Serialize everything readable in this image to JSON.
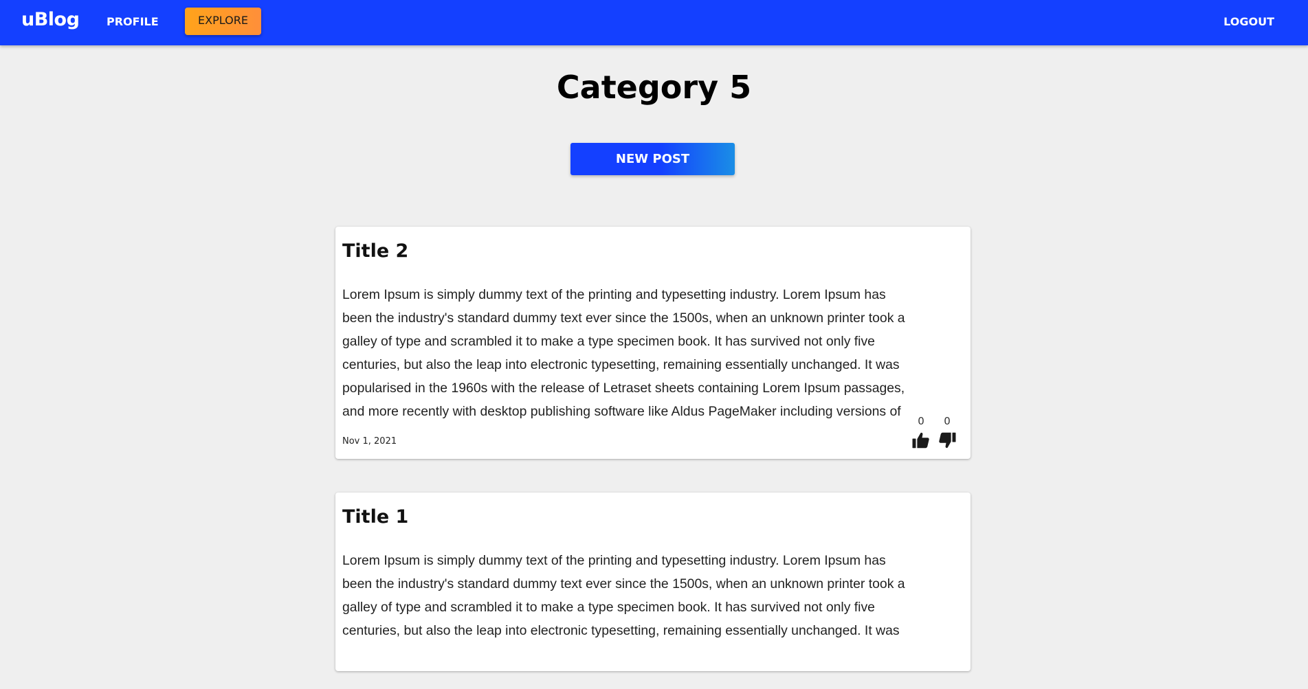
{
  "navbar": {
    "brand": "uBlog",
    "profile_label": "PROFILE",
    "explore_label": "EXPLORE",
    "logout_label": "LOGOUT"
  },
  "page": {
    "title": "Category 5",
    "new_post_label": "NEW POST"
  },
  "posts": [
    {
      "title": "Title 2",
      "body": "Lorem Ipsum is simply dummy text of the printing and typesetting industry. Lorem Ipsum has been the industry's standard dummy text ever since the 1500s, when an unknown printer took a galley of type and scrambled it to make a type specimen book. It has survived not only five centuries, but also the leap into electronic typesetting, remaining essentially unchanged. It was popularised in the 1960s with the release of Letraset sheets containing Lorem Ipsum passages, and more recently with desktop publishing software like Aldus PageMaker including versions of",
      "date": "Nov 1, 2021",
      "likes": "0",
      "dislikes": "0"
    },
    {
      "title": "Title 1",
      "body": "Lorem Ipsum is simply dummy text of the printing and typesetting industry. Lorem Ipsum has been the industry's standard dummy text ever since the 1500s, when an unknown printer took a galley of type and scrambled it to make a type specimen book. It has survived not only five centuries, but also the leap into electronic typesetting, remaining essentially unchanged. It was"
    }
  ],
  "icons": {
    "like": "thumbs-up-icon",
    "dislike": "thumbs-down-icon"
  },
  "colors": {
    "navbar": "#1440ff",
    "explore_button": "#ffa31a",
    "new_post_button": "#1440ff",
    "background": "#efefef"
  }
}
